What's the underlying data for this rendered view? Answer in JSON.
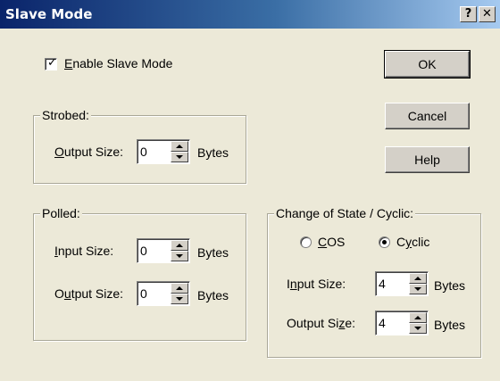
{
  "window": {
    "title": "Slave Mode",
    "help_glyph": "?",
    "close_glyph": "✕"
  },
  "enable": {
    "label_accel": "E",
    "label_rest": "nable Slave Mode",
    "checked": true
  },
  "buttons": {
    "ok": "OK",
    "cancel": "Cancel",
    "help": "Help"
  },
  "strobed": {
    "title": "Strobed:",
    "output_label_accel": "O",
    "output_label_rest": "utput Size:",
    "output_value": "0",
    "unit": "Bytes"
  },
  "polled": {
    "title": "Polled:",
    "input_label_accel": "I",
    "input_label_rest": "nput Size:",
    "input_value": "0",
    "output_label_pre": "O",
    "output_label_accel": "u",
    "output_label_rest": "tput Size:",
    "output_value": "0",
    "unit": "Bytes"
  },
  "cos": {
    "title": "Change of State / Cyclic:",
    "radio_cos_accel": "C",
    "radio_cos_rest": "OS",
    "radio_cyclic_pre": "C",
    "radio_cyclic_accel": "y",
    "radio_cyclic_rest": "clic",
    "selected": "Cyclic",
    "input_label_pre": "I",
    "input_label_accel": "n",
    "input_label_rest": "put Size:",
    "input_value": "4",
    "output_label_pre": "Output Si",
    "output_label_accel": "z",
    "output_label_rest": "e:",
    "output_value": "4",
    "unit": "Bytes"
  }
}
